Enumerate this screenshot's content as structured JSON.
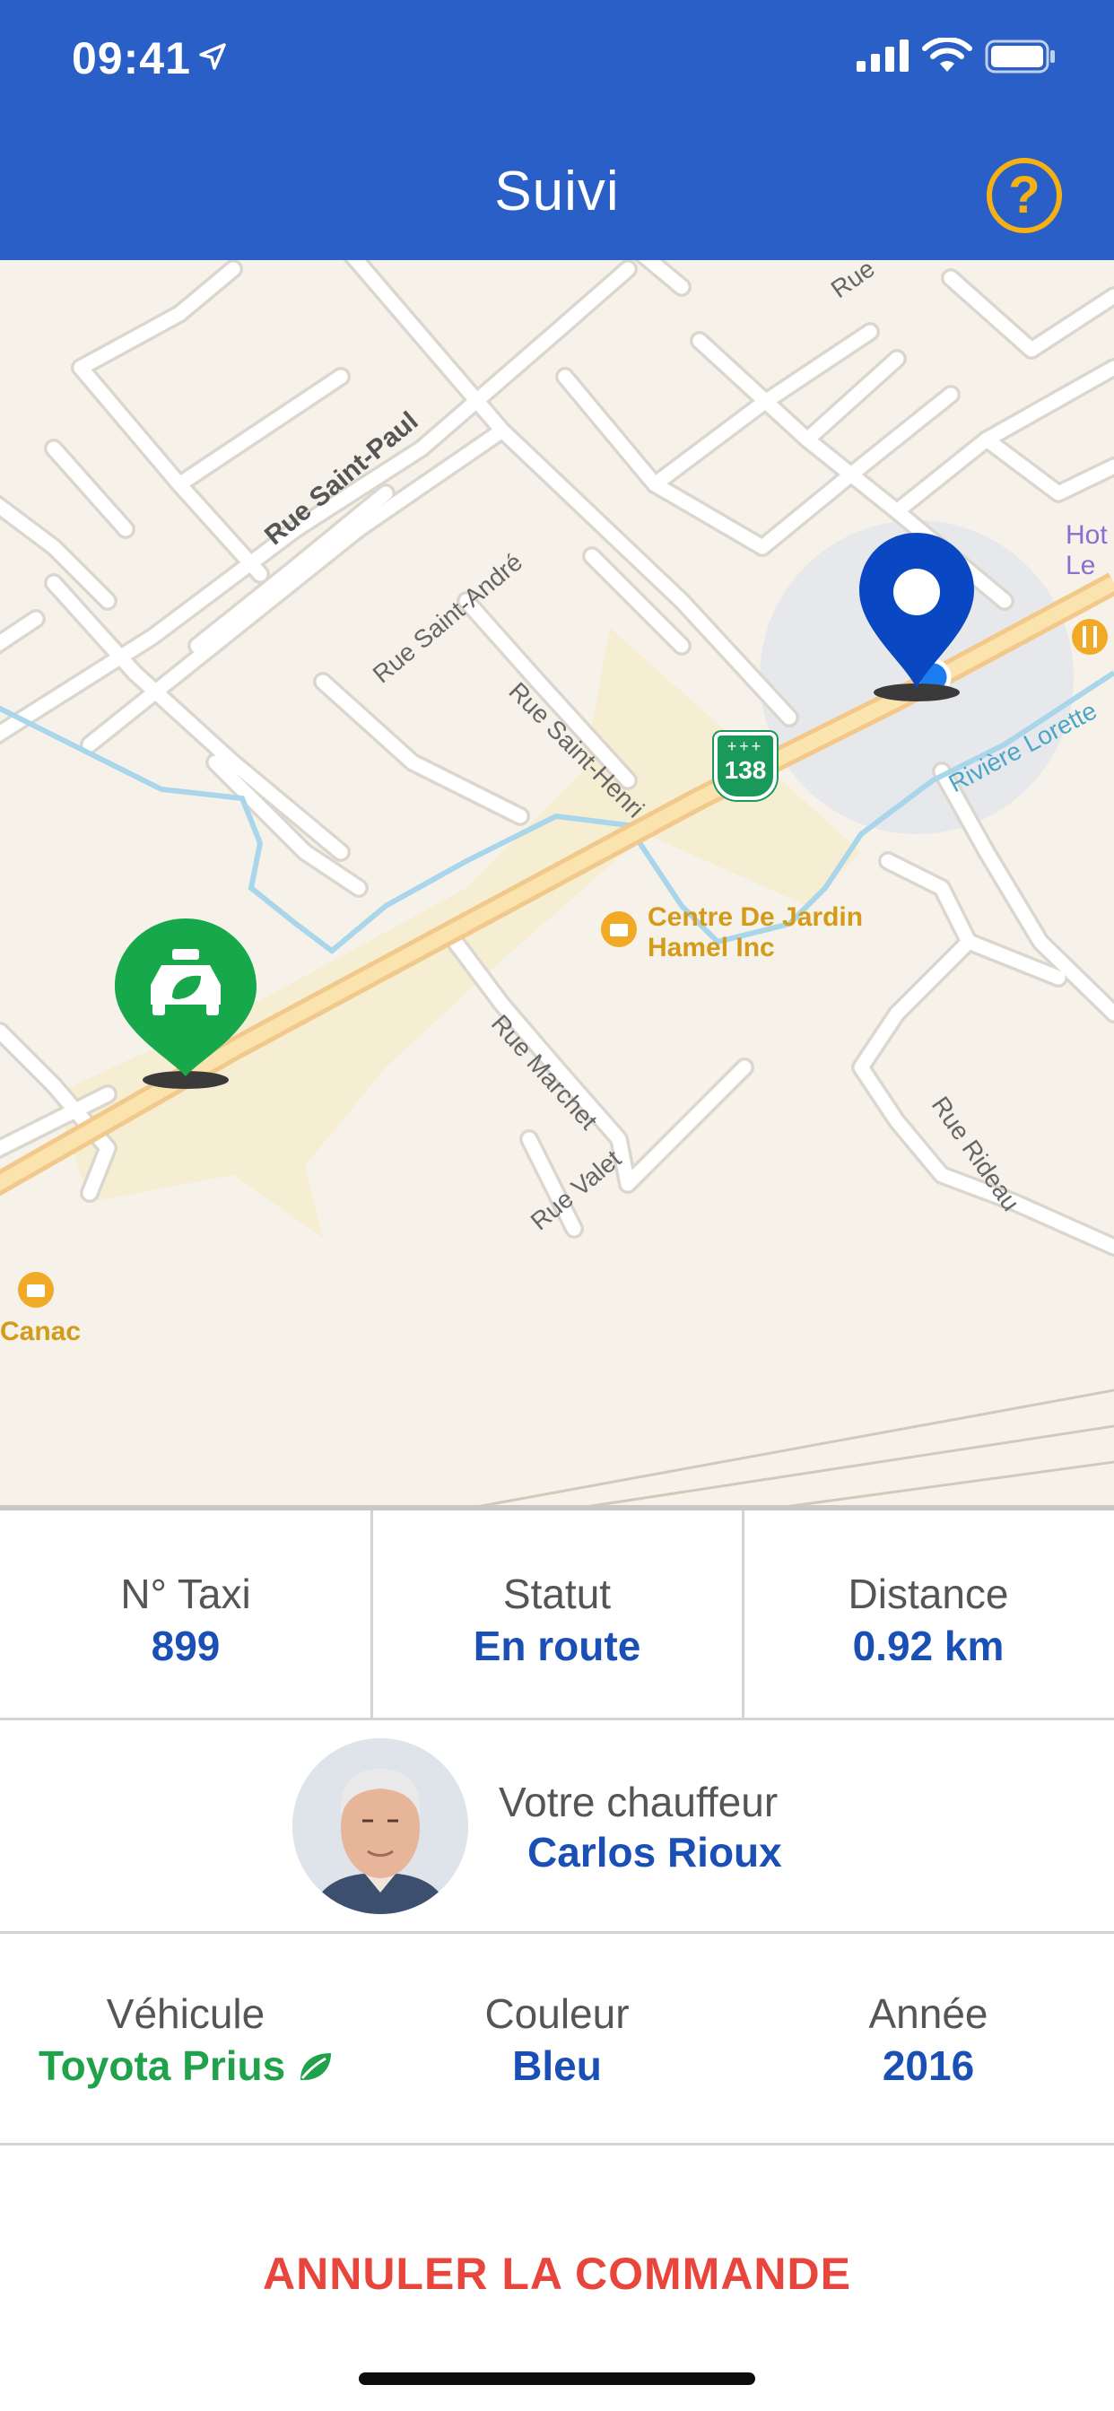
{
  "status_bar": {
    "time": "09:41"
  },
  "header": {
    "title": "Suivi",
    "help_label": "?"
  },
  "map": {
    "streets": [
      "Rue Saint-Paul",
      "Rue Saint-André",
      "Rue Saint-Henri",
      "Rue Marchet",
      "Rue Valet",
      "Rue Rideau",
      "Rue"
    ],
    "route_shield": "138",
    "river": "Rivière Lorette",
    "poi_garden": [
      "Centre De Jardin",
      "Hamel Inc"
    ],
    "poi_canac": "Canac",
    "hotel": [
      "Hot",
      "Le"
    ]
  },
  "trip": {
    "taxi_label": "N° Taxi",
    "taxi_value": "899",
    "status_label": "Statut",
    "status_value": "En route",
    "distance_label": "Distance",
    "distance_value": "0.92 km"
  },
  "driver": {
    "label": "Votre chauffeur",
    "name": "Carlos Rioux"
  },
  "vehicle": {
    "vehicle_label": "Véhicule",
    "vehicle_value": "Toyota Prius",
    "color_label": "Couleur",
    "color_value": "Bleu",
    "year_label": "Année",
    "year_value": "2016"
  },
  "actions": {
    "cancel_label": "ANNULER LA COMMANDE"
  },
  "colors": {
    "header": "#2a5fc7",
    "accent": "#1a4fb6",
    "eco_green": "#1fa24a",
    "cancel_red": "#e8453c",
    "help_yellow": "#f5b114"
  }
}
